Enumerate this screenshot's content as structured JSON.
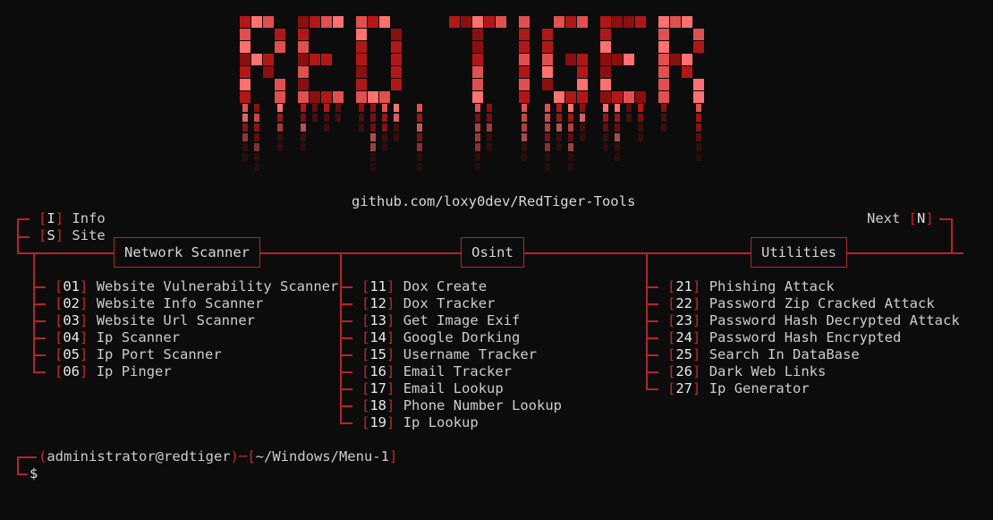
{
  "banner": {
    "text": "RED TIGER",
    "colors": [
      "#e05050",
      "#b01818",
      "#ff7070",
      "#8a1010"
    ]
  },
  "github": "github.com/loxy0dev/RedTiger-Tools",
  "top_left": [
    {
      "key": "I",
      "label": "Info"
    },
    {
      "key": "S",
      "label": "Site"
    }
  ],
  "top_right": {
    "label": "Next",
    "key": "N"
  },
  "columns": [
    {
      "title": "Network Scanner",
      "items": [
        {
          "num": "01",
          "label": "Website Vulnerability Scanner"
        },
        {
          "num": "02",
          "label": "Website Info Scanner"
        },
        {
          "num": "03",
          "label": "Website Url Scanner"
        },
        {
          "num": "04",
          "label": "Ip Scanner"
        },
        {
          "num": "05",
          "label": "Ip Port Scanner"
        },
        {
          "num": "06",
          "label": "Ip Pinger"
        }
      ]
    },
    {
      "title": "Osint",
      "items": [
        {
          "num": "11",
          "label": "Dox Create"
        },
        {
          "num": "12",
          "label": "Dox Tracker"
        },
        {
          "num": "13",
          "label": "Get Image Exif"
        },
        {
          "num": "14",
          "label": "Google Dorking"
        },
        {
          "num": "15",
          "label": "Username Tracker"
        },
        {
          "num": "16",
          "label": "Email Tracker"
        },
        {
          "num": "17",
          "label": "Email Lookup"
        },
        {
          "num": "18",
          "label": "Phone Number Lookup"
        },
        {
          "num": "19",
          "label": "Ip Lookup"
        }
      ]
    },
    {
      "title": "Utilities",
      "items": [
        {
          "num": "21",
          "label": "Phishing Attack"
        },
        {
          "num": "22",
          "label": "Password Zip Cracked Attack"
        },
        {
          "num": "23",
          "label": "Password Hash Decrypted Attack"
        },
        {
          "num": "24",
          "label": "Password Hash Encrypted"
        },
        {
          "num": "25",
          "label": "Search In DataBase"
        },
        {
          "num": "26",
          "label": "Dark Web Links"
        },
        {
          "num": "27",
          "label": "Ip Generator"
        }
      ]
    }
  ],
  "prompt": {
    "user": "administrator@redtiger",
    "path": "~/Windows/Menu-1",
    "symbol": "$"
  }
}
